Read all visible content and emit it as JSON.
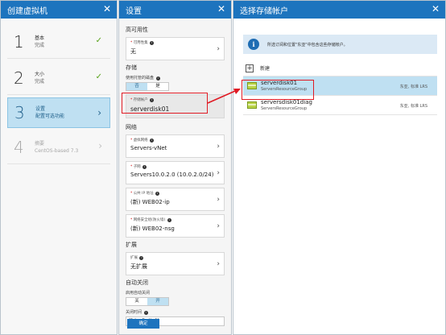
{
  "blade1": {
    "title": "创建虚拟机",
    "close": "✕",
    "steps": [
      {
        "num": "1",
        "title": "基本",
        "status": "完成",
        "mark": "✓"
      },
      {
        "num": "2",
        "title": "大小",
        "status": "完成",
        "mark": "✓"
      },
      {
        "num": "3",
        "title": "设置",
        "status": "配置可选功能",
        "mark": "›"
      },
      {
        "num": "4",
        "title": "摘要",
        "status": "CentOS-based 7.3",
        "mark": "›"
      }
    ]
  },
  "blade2": {
    "title": "设置",
    "close": "✕",
    "ha": {
      "section": "高可用性",
      "label": "可用性集",
      "value": "无"
    },
    "storage": {
      "section": "存储",
      "managed_label": "使用托管的磁盘",
      "toggle_no": "否",
      "toggle_yes": "是",
      "account_label": "存储帐户",
      "account_value": "serverdisk01"
    },
    "network": {
      "section": "网络",
      "vnet_label": "虚拟网络",
      "vnet_value": "Servers-vNet",
      "subnet_label": "子网",
      "subnet_value": "Servers10.0.2.0 (10.0.2.0/24)",
      "pip_label": "公共 IP 地址",
      "pip_value": "(新) WEB02-ip",
      "nsg_label": "网络安全组(防火墙)",
      "nsg_value": "(新) WEB02-nsg"
    },
    "extensions": {
      "section": "扩展",
      "label": "扩展",
      "value": "无扩展"
    },
    "autoshutdown": {
      "section": "自动关闭",
      "enable_label": "启用自动关闭",
      "toggle_off": "关",
      "toggle_on": "开",
      "time_label": "关闭时间",
      "time_value": "晚上7点0分0秒"
    },
    "ok": "确定"
  },
  "blade3": {
    "title": "选择存储帐户",
    "close": "✕",
    "info_text": "所选订阅和位置\"东亚\"中包含这些存储帐户。",
    "new_label": "新建",
    "accounts": [
      {
        "name": "serverdisk01",
        "group": "ServersResourceGroup",
        "location": "东亚, 标准 LRS",
        "selected": true
      },
      {
        "name": "serversdisk01diag",
        "group": "ServersResourceGroup",
        "location": "东亚, 标准 LRS",
        "selected": false
      }
    ]
  },
  "colors": {
    "header_blue": "#1d74be",
    "selected_blue": "#bfe0f2",
    "highlight_red": "#e01b24",
    "check_green": "#58a21a"
  }
}
